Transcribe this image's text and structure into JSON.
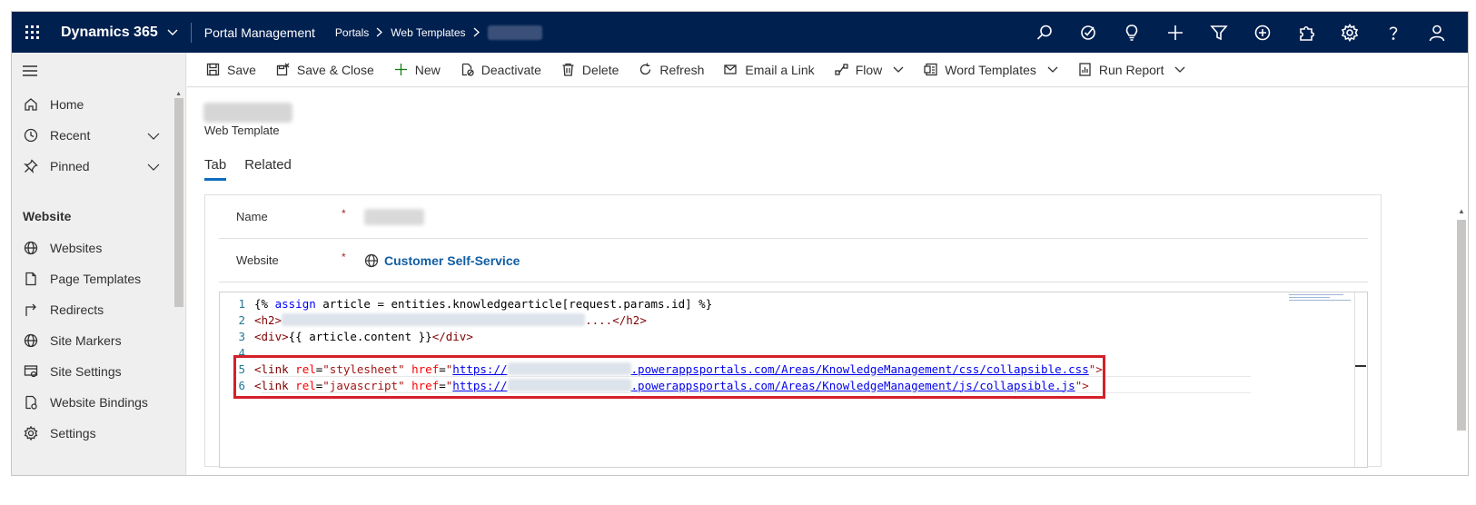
{
  "topbar": {
    "brand": "Dynamics 365",
    "app_name": "Portal Management",
    "breadcrumbs": [
      "Portals",
      "Web Templates"
    ],
    "icons": [
      "search-icon",
      "task-icon",
      "lightbulb-icon",
      "plus-icon",
      "filter-icon",
      "circle-plus-icon",
      "puzzle-icon",
      "settings-icon",
      "help-icon",
      "user-icon"
    ]
  },
  "sidebar": {
    "items": [
      {
        "label": "Home",
        "icon": "home-icon"
      },
      {
        "label": "Recent",
        "icon": "clock-icon"
      },
      {
        "label": "Pinned",
        "icon": "pin-icon"
      }
    ],
    "section_title": "Website",
    "section_items": [
      {
        "label": "Websites",
        "icon": "globe-icon"
      },
      {
        "label": "Page Templates",
        "icon": "page-icon"
      },
      {
        "label": "Redirects",
        "icon": "redirect-icon"
      },
      {
        "label": "Site Markers",
        "icon": "globe-icon"
      },
      {
        "label": "Site Settings",
        "icon": "site-settings-icon"
      },
      {
        "label": "Website Bindings",
        "icon": "bindings-icon"
      },
      {
        "label": "Settings",
        "icon": "gear-icon"
      }
    ]
  },
  "commands": {
    "save": "Save",
    "save_close": "Save & Close",
    "new": "New",
    "deactivate": "Deactivate",
    "delete": "Delete",
    "refresh": "Refresh",
    "email_link": "Email a Link",
    "flow": "Flow",
    "word_templates": "Word Templates",
    "run_report": "Run Report"
  },
  "record": {
    "type": "Web Template",
    "tabs": [
      "Tab",
      "Related"
    ]
  },
  "form": {
    "name_label": "Name",
    "website_label": "Website",
    "required_mark": "*",
    "website_value": "Customer Self-Service"
  },
  "code": {
    "line_numbers": [
      "1",
      "2",
      "3",
      "4",
      "5",
      "6"
    ],
    "l1_open": "{%",
    "l1_kw": "assign",
    "l1_rest": " article = entities.knowledgearticle[request.params.id] %}",
    "l2_open": "<h2>",
    "l2_close": "....</h2>",
    "l3_open": "<div>",
    "l3_mid": "{{ article.content }}",
    "l3_close": "</div>",
    "link_tag": "<link",
    "rel_attr": "rel",
    "eq": "=",
    "href_attr": "href",
    "stylesheet": "\"stylesheet\"",
    "javascript": "\"javascript\"",
    "url_prefix": "https://",
    "css_suffix": ".powerappsportals.com/Areas/KnowledgeManagement/css/collapsible.css",
    "js_suffix": ".powerappsportals.com/Areas/KnowledgeManagement/js/collapsible.js",
    "quote_open": "\"",
    "end_tag": "\">"
  }
}
